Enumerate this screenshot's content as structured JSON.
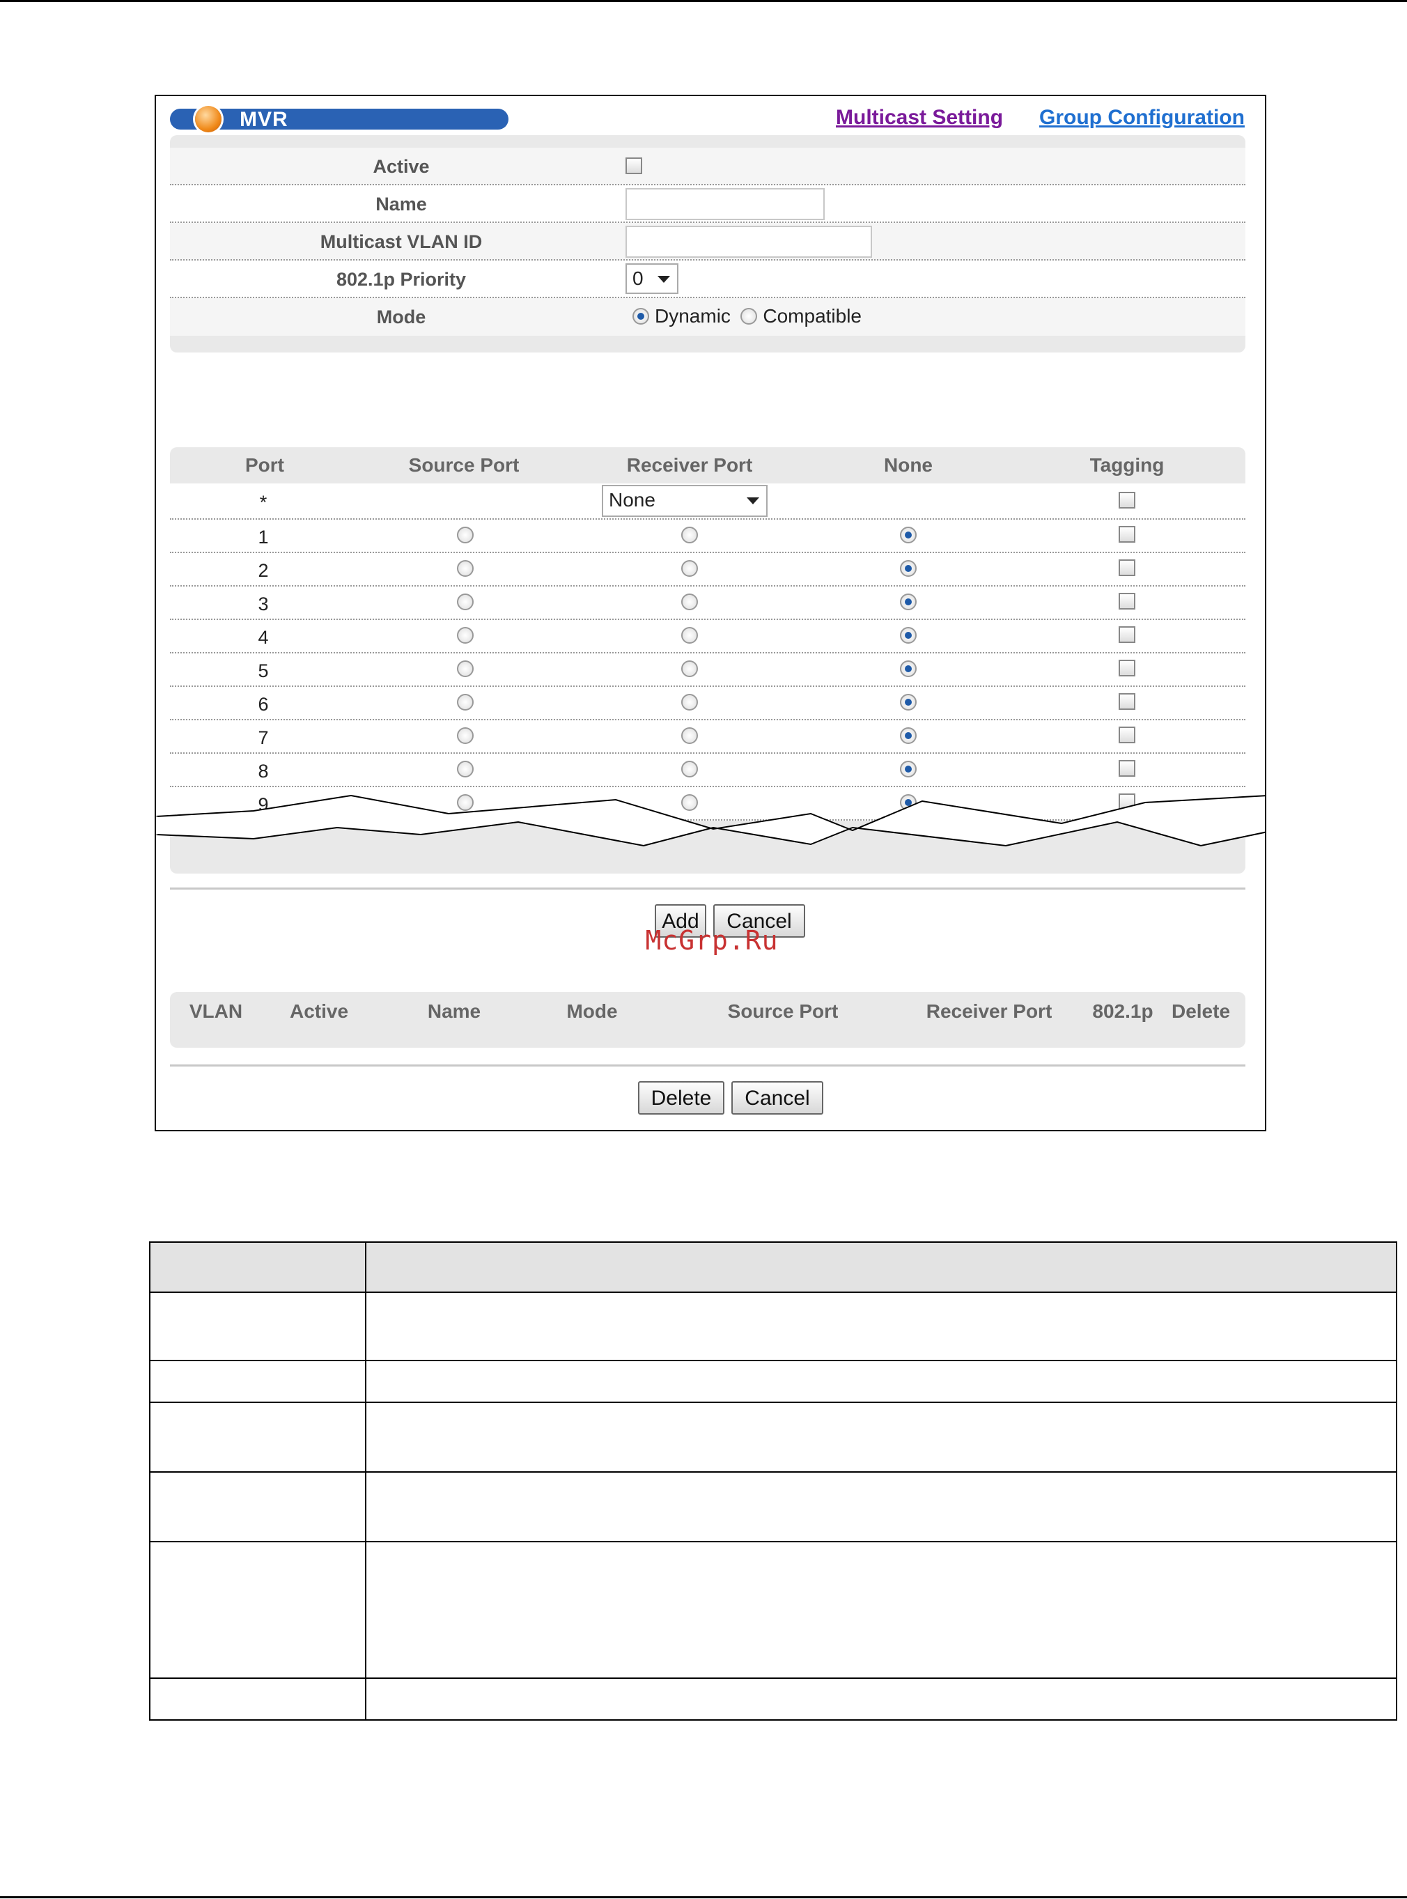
{
  "header": {
    "title": "MVR",
    "links": [
      "Multicast Setting",
      "Group Configuration"
    ]
  },
  "form": {
    "active_label": "Active",
    "name_label": "Name",
    "vlan_label": "Multicast VLAN ID",
    "priority_label": "802.1p Priority",
    "priority_value": "0",
    "mode_label": "Mode",
    "mode_dynamic": "Dynamic",
    "mode_compatible": "Compatible",
    "mode_selected": "Dynamic"
  },
  "port_table": {
    "headers": [
      "Port",
      "Source Port",
      "Receiver Port",
      "None",
      "Tagging"
    ],
    "all_row_port": "*",
    "all_row_select": "None",
    "rows": [
      {
        "port": "1"
      },
      {
        "port": "2"
      },
      {
        "port": "3"
      },
      {
        "port": "4"
      },
      {
        "port": "5"
      },
      {
        "port": "6"
      },
      {
        "port": "7"
      },
      {
        "port": "8"
      },
      {
        "port": "9"
      }
    ]
  },
  "buttons": {
    "add": "Add",
    "cancel": "Cancel",
    "delete": "Delete",
    "cancel2": "Cancel"
  },
  "watermark": "McGrp.Ru",
  "vlan_table": {
    "headers": [
      "VLAN",
      "Active",
      "Name",
      "Mode",
      "Source Port",
      "Receiver Port",
      "802.1p",
      "Delete"
    ]
  }
}
